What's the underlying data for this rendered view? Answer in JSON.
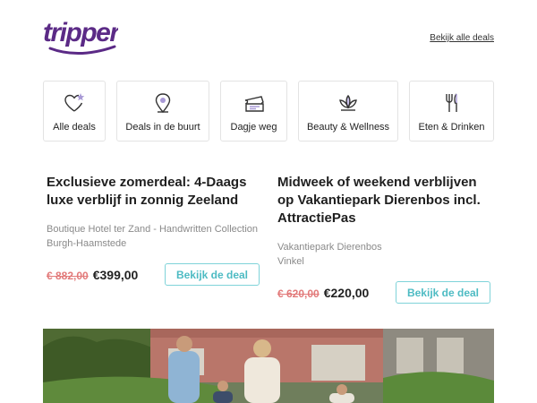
{
  "header": {
    "logo_text": "tripper",
    "all_deals_link": "Bekijk alle deals"
  },
  "categories": [
    {
      "label": "Alle deals",
      "icon": "heart-star-icon"
    },
    {
      "label": "Deals in de buurt",
      "icon": "location-pin-icon"
    },
    {
      "label": "Dagje weg",
      "icon": "ticket-icon"
    },
    {
      "label": "Beauty & Wellness",
      "icon": "lotus-icon"
    },
    {
      "label": "Eten & Drinken",
      "icon": "fork-knife-icon"
    }
  ],
  "deals": [
    {
      "title": "Exclusieve zomerdeal: 4-Daags luxe verblijf in zonnig Zeeland",
      "venue_line1": "Boutique Hotel ter Zand - Handwritten Collection",
      "venue_line2": "Burgh-Haamstede",
      "old_price": "€ 882,00",
      "new_price": "€399,00",
      "button": "Bekijk de deal"
    },
    {
      "title": "Midweek of weekend verblijven op Vakantiepark Dierenbos incl. AttractiePas",
      "venue_line1": "Vakantiepark Dierenbos",
      "venue_line2": "Vinkel",
      "old_price": "€ 620,00",
      "new_price": "€220,00",
      "button": "Bekijk de deal"
    }
  ],
  "colors": {
    "brand_purple": "#5b2a86",
    "accent_teal": "#4dbbc3",
    "old_price_red": "#e27a7a"
  },
  "hero": {
    "image": "family-walking-holiday-park-photo"
  }
}
